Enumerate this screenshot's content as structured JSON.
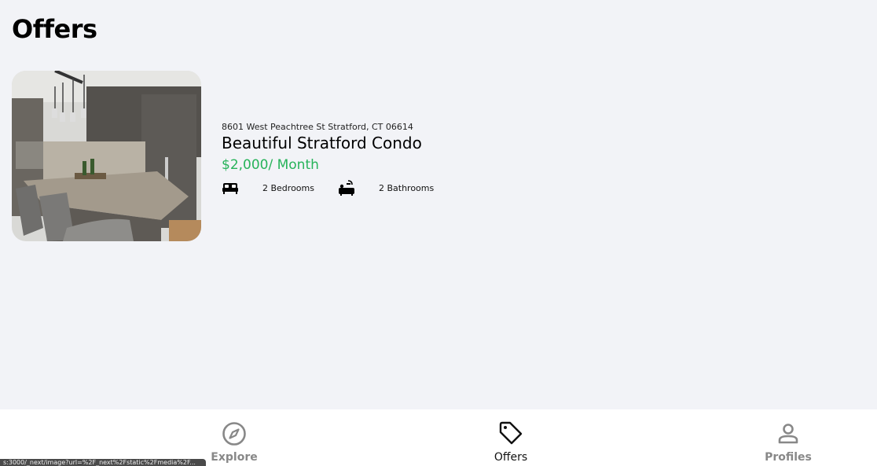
{
  "page": {
    "title": "Offers"
  },
  "offer": {
    "address": "8601 West Peachtree St Stratford, CT 06614",
    "title": "Beautiful Stratford Condo",
    "price": "$2,000/ Month",
    "bedrooms_label": "2 Bedrooms",
    "bathrooms_label": "2 Bathrooms",
    "image_icon": "kitchen-photo",
    "bed_icon": "bed-icon",
    "bath_icon": "bathtub-icon",
    "price_color": "#27b35a"
  },
  "nav": {
    "items": [
      {
        "label": "Explore",
        "icon": "compass-icon",
        "active": false
      },
      {
        "label": "Offers",
        "icon": "tag-icon",
        "active": true
      },
      {
        "label": "Profiles",
        "icon": "person-icon",
        "active": false
      }
    ]
  },
  "status_bar": {
    "url": "s:3000/_next/image?url=%2F_next%2Fstatic%2Fmedia%2F..."
  }
}
